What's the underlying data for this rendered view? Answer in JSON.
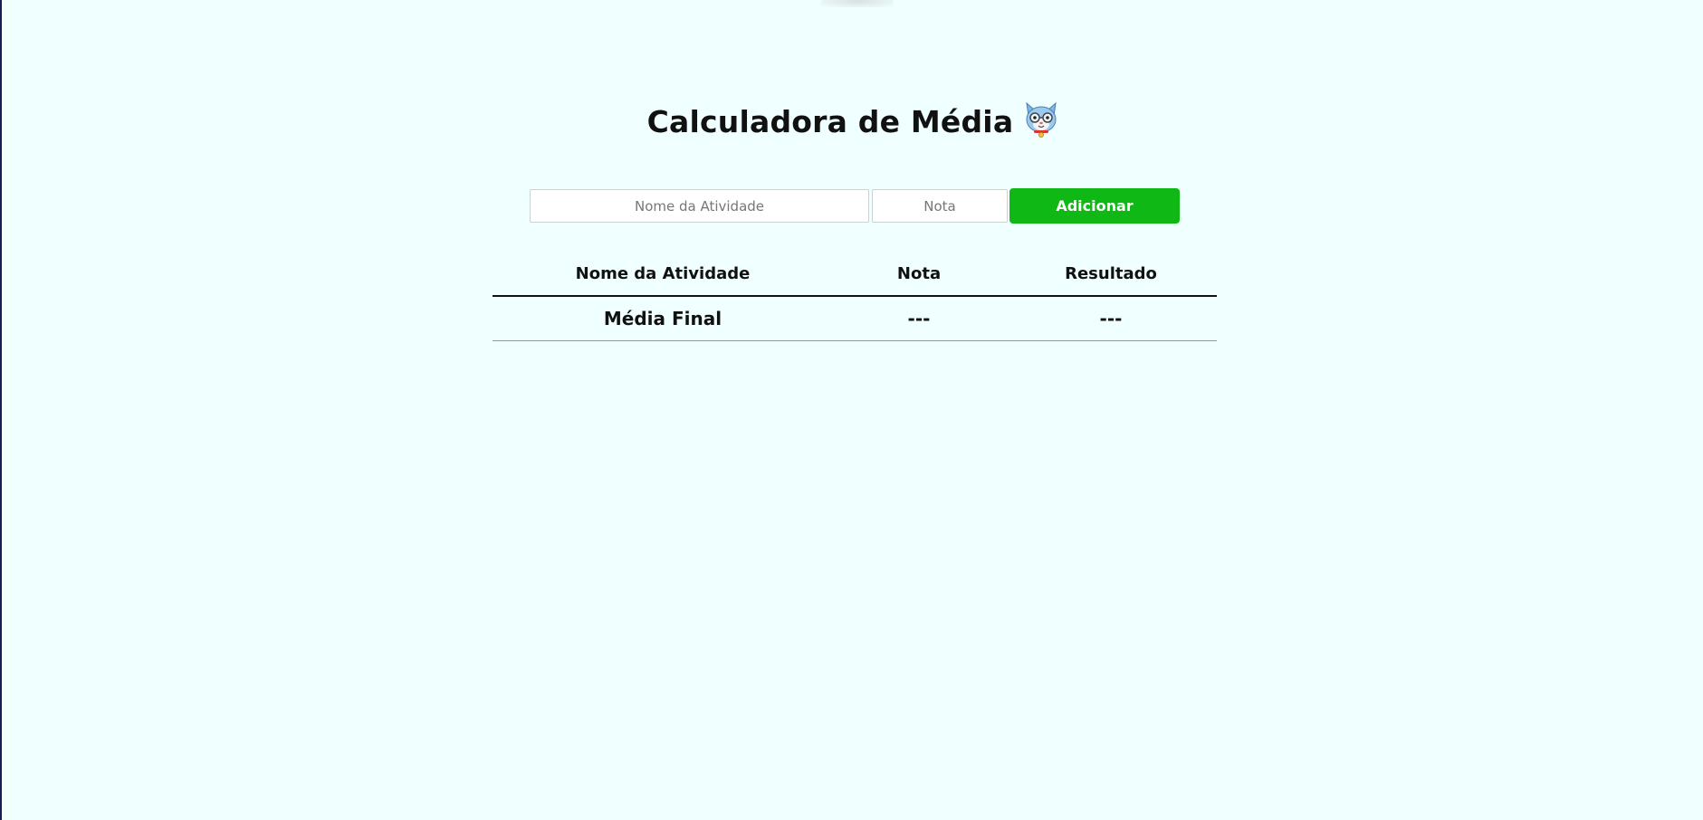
{
  "header": {
    "title": "Calculadora de Média",
    "mascot_icon": "cat-mascot-icon"
  },
  "form": {
    "activity_placeholder": "Nome da Atividade",
    "grade_placeholder": "Nota",
    "add_label": "Adicionar"
  },
  "table": {
    "headers": [
      "Nome da Atividade",
      "Nota",
      "Resultado"
    ],
    "footer": {
      "label": "Média Final",
      "grade": "---",
      "result": "---"
    }
  },
  "colors": {
    "background": "#f0ffff",
    "button": "#0fb815"
  }
}
